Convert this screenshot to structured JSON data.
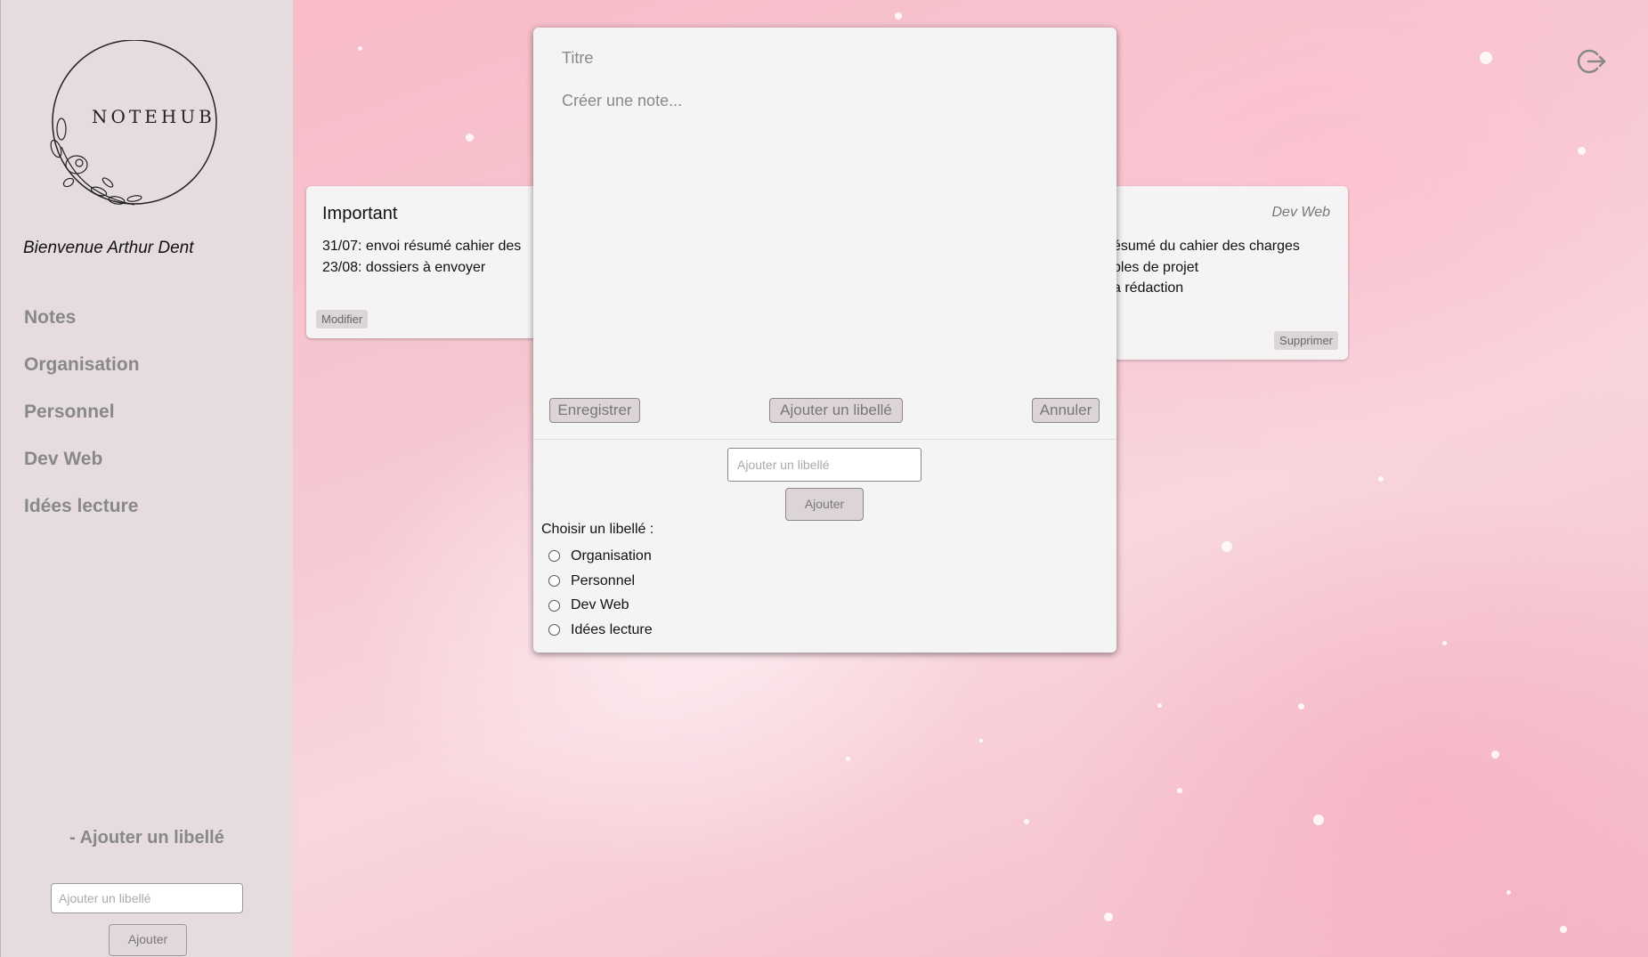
{
  "sidebar": {
    "logo": "NOTEHUB",
    "welcome": "Bienvenue Arthur Dent",
    "nav": [
      "Notes",
      "Organisation",
      "Personnel",
      "Dev Web",
      "Idées lecture"
    ],
    "add_title": "- Ajouter un libellé",
    "add_placeholder": "Ajouter un libellé",
    "add_button": "Ajouter"
  },
  "cards": {
    "left": {
      "title": "Important",
      "body": "31/07: envoi résumé cahier des\n23/08: dossiers à envoyer",
      "button": "Modifier"
    },
    "right": {
      "label": "Dev Web",
      "body": "ésumé du cahier des charges\nbles de projet\na rédaction",
      "button": "Supprimer"
    }
  },
  "modal": {
    "title_placeholder": "Titre",
    "body_placeholder": "Créer une note...",
    "save_button": "Enregistrer",
    "add_label_button": "Ajouter un libellé",
    "cancel_button": "Annuler",
    "label_input_placeholder": "Ajouter un libellé",
    "label_add_button": "Ajouter",
    "choose_title": "Choisir un libellé :",
    "options": [
      "Organisation",
      "Personnel",
      "Dev Web",
      "Idées lecture"
    ]
  },
  "icons": {
    "logout": "logout-icon"
  }
}
